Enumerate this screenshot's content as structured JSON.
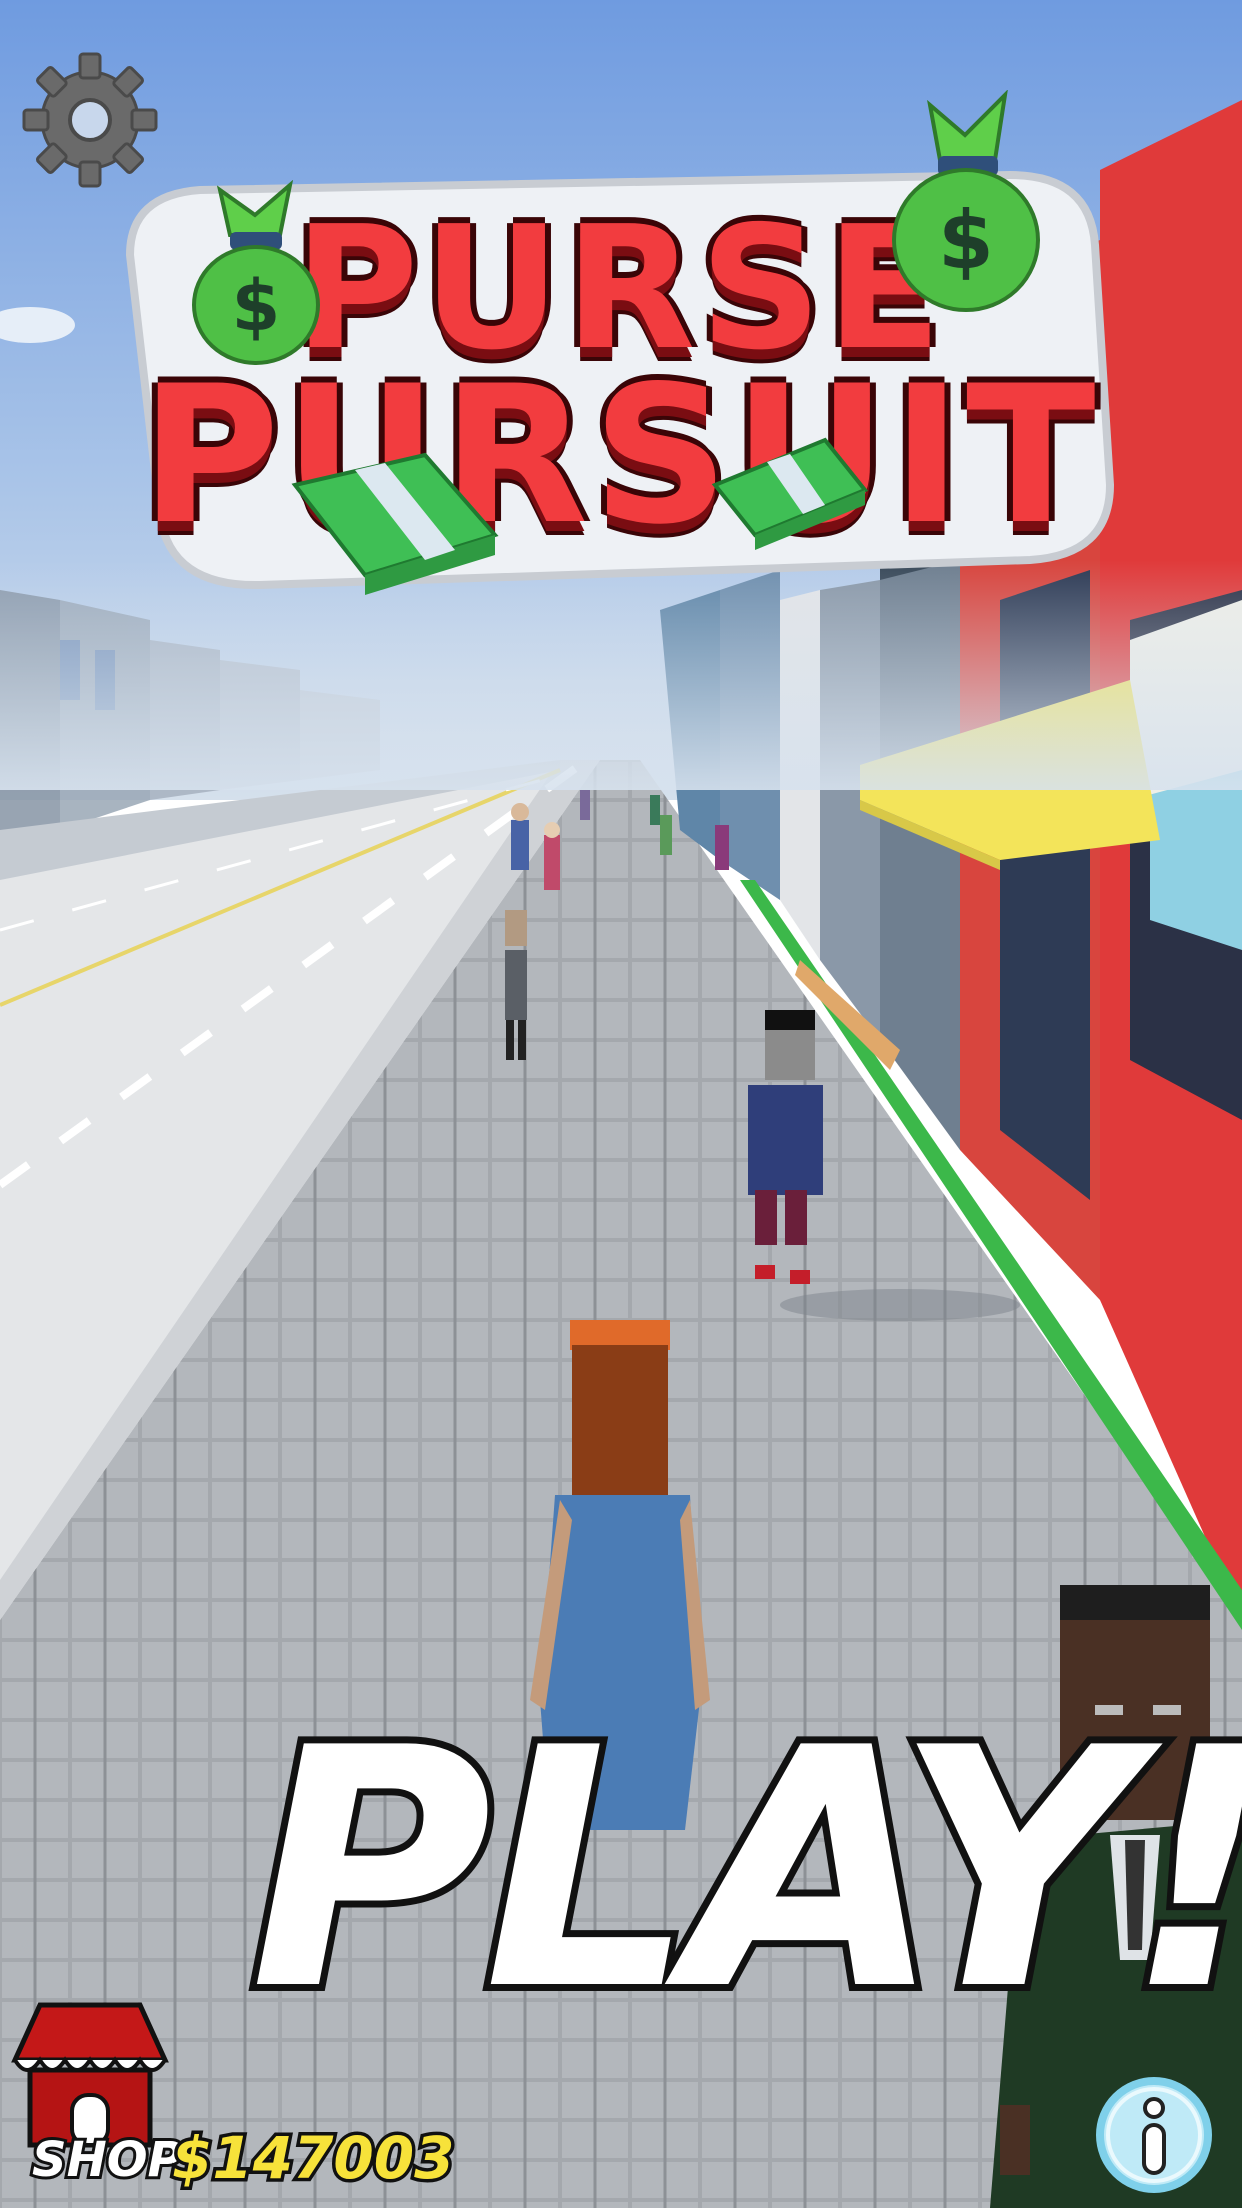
{
  "title": {
    "line1": "PURSE",
    "line2": "PURSUIT"
  },
  "play": {
    "label": "PLAY!"
  },
  "shop": {
    "label": "SHOP",
    "money": "$147003"
  },
  "icons": {
    "settings": "gear-icon",
    "shop": "shop-awning-icon",
    "info": "info-icon",
    "money_bag": "money-bag-icon",
    "cash": "cash-stack-icon"
  },
  "colors": {
    "sky": "#7fa6e0",
    "logo_red": "#f23c3f",
    "money_yellow": "#f7e23a",
    "info_blue": "#bfeaf7",
    "shop_red": "#b51414"
  }
}
